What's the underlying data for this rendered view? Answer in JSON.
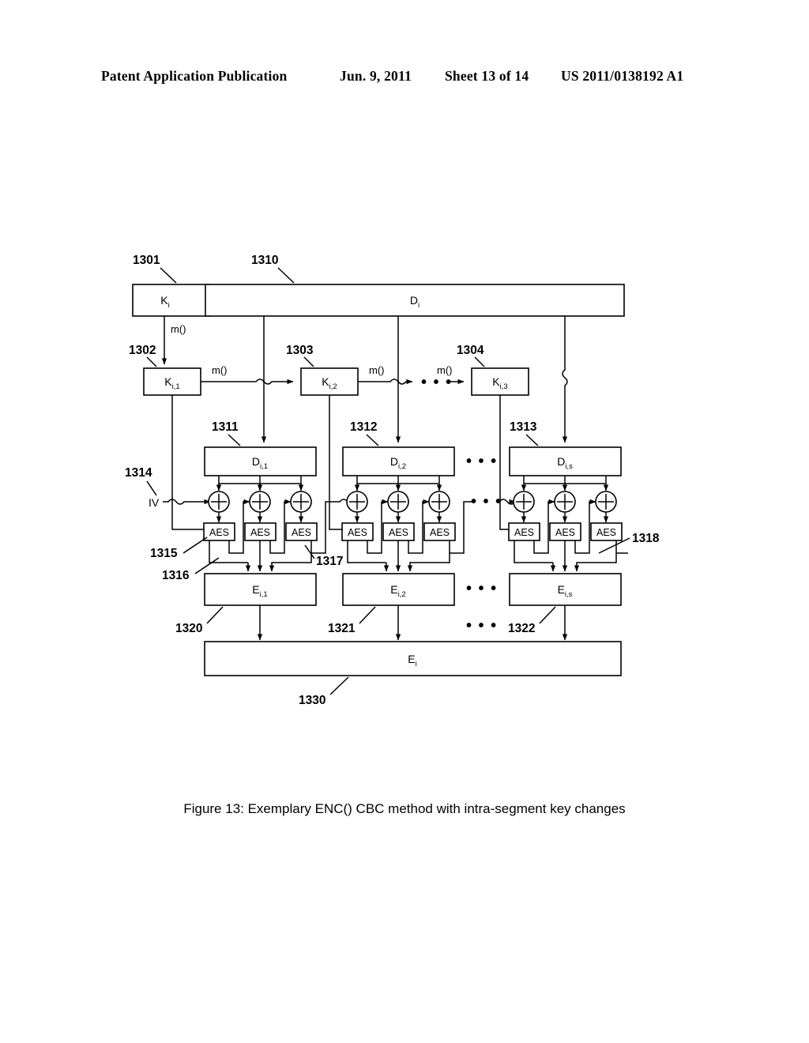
{
  "header": {
    "publication": "Patent Application Publication",
    "date": "Jun. 9, 2011",
    "sheet": "Sheet 13 of 14",
    "patent_number": "US 2011/0138192 A1"
  },
  "caption": "Figure 13: Exemplary ENC() CBC method with intra-segment key changes",
  "diagram": {
    "key_master": {
      "label": "K",
      "sub": "i",
      "ref": "1301"
    },
    "data_master": {
      "label": "D",
      "sub": "i",
      "ref": "1310"
    },
    "result_master": {
      "label": "E",
      "sub": "i",
      "ref": "1330"
    },
    "iv_label": "IV",
    "iv_ref": "1314",
    "m_label": "m()",
    "aes_label": "AES",
    "ellipsis": "• • •",
    "subkeys": [
      {
        "label": "K",
        "sub": "i,1",
        "ref": "1302"
      },
      {
        "label": "K",
        "sub": "i,2",
        "ref": "1303"
      },
      {
        "label": "K",
        "sub": "i,3",
        "ref": "1304"
      }
    ],
    "data_blocks": [
      {
        "label": "D",
        "sub": "i,1",
        "ref": "1311"
      },
      {
        "label": "D",
        "sub": "i,2",
        "ref": "1312"
      },
      {
        "label": "D",
        "sub": "i,s",
        "ref": "1313"
      }
    ],
    "enc_blocks": [
      {
        "label": "E",
        "sub": "i,1",
        "ref": "1320"
      },
      {
        "label": "E",
        "sub": "i,2",
        "ref": "1321"
      },
      {
        "label": "E",
        "sub": "i,s",
        "ref": "1322"
      }
    ],
    "aes_refs": [
      "1315",
      "1316",
      "1317",
      "1318"
    ]
  }
}
